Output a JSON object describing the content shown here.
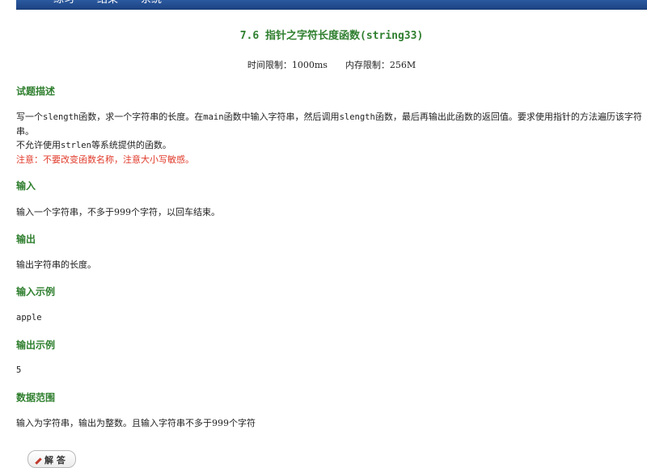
{
  "nav": {
    "items": [
      "练习",
      "结果",
      "系统"
    ]
  },
  "problem": {
    "title": "7.6 指针之字符长度函数(string33)",
    "time_limit": "时间限制：1000ms",
    "memory_limit": "内存限制：256M"
  },
  "description": {
    "heading": "试题描述",
    "line1_a": "写一个",
    "line1_code1": "slength",
    "line1_b": "函数，求一个字符串的长度。在",
    "line1_code2": "main",
    "line1_c": "函数中输入字符串，然后调用",
    "line1_code3": "slength",
    "line1_d": "函数，最后再输出此函数的返回值。要求使用指针的方法遍历该字符串。",
    "line2_a": "不允许使用",
    "line2_code": "strlen",
    "line2_b": "等系统提供的函数。",
    "warning": "注意：不要改变函数名称，注意大小写敏感。"
  },
  "input": {
    "heading": "输入",
    "text": "输入一个字符串，不多于999个字符，以回车结束。"
  },
  "output": {
    "heading": "输出",
    "text": "输出字符串的长度。"
  },
  "sample_input": {
    "heading": "输入示例",
    "text": "apple"
  },
  "sample_output": {
    "heading": "输出示例",
    "text": "5"
  },
  "data_range": {
    "heading": "数据范围",
    "text": "输入为字符串，输出为整数。且输入字符串不多于999个字符"
  },
  "answer_button": {
    "label": "解 答",
    "icon": "pencil-icon"
  }
}
